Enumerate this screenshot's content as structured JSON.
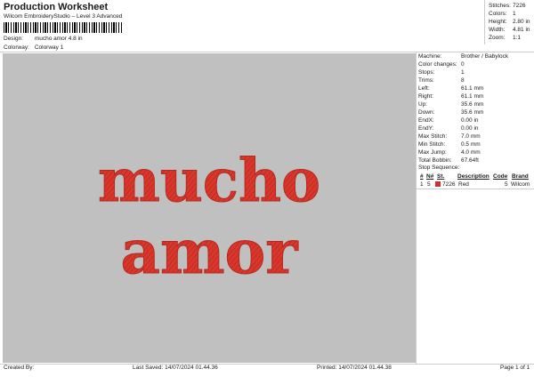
{
  "header": {
    "title": "Production Worksheet",
    "subtitle": "Wilcom EmbroideryStudio – Level 3 Advanced",
    "design_label": "Design:",
    "design_value": "mucho amor 4.8 in",
    "colorway_label": "Colorway:",
    "colorway_value": "Colorway 1"
  },
  "stats": {
    "stitches_label": "Stitches:",
    "stitches": "7226",
    "colors_label": "Colors:",
    "colors": "1",
    "height_label": "Height:",
    "height": "2.80 in",
    "width_label": "Width:",
    "width": "4.81 in",
    "zoom_label": "Zoom:",
    "zoom": "1:1"
  },
  "design": {
    "line1": "mucho",
    "line2": "amor",
    "thread_color": "#d9362c",
    "canvas_color": "#c0c0c0"
  },
  "properties": {
    "machine_label": "Machine:",
    "machine": "Brother / Babylock",
    "color_changes_label": "Color changes:",
    "color_changes": "0",
    "stops_label": "Stops:",
    "stops": "1",
    "trims_label": "Trims:",
    "trims": "8",
    "left_label": "Left:",
    "left": "61.1 mm",
    "right_label": "Right:",
    "right": "61.1 mm",
    "up_label": "Up:",
    "up": "35.6 mm",
    "down_label": "Down:",
    "down": "35.6 mm",
    "endx_label": "EndX:",
    "endx": "0.00 in",
    "endy_label": "EndY:",
    "endy": "0.00 in",
    "max_stitch_label": "Max Stitch:",
    "max_stitch": "7.0 mm",
    "min_stitch_label": "Min Stitch:",
    "min_stitch": "0.5 mm",
    "max_jump_label": "Max Jump:",
    "max_jump": "4.0 mm",
    "total_bobbin_label": "Total Bobbin:",
    "total_bobbin": "67.64ft"
  },
  "stop_sequence": {
    "title": "Stop Sequence:",
    "headers": {
      "num": "#",
      "n": "N#",
      "st": "St.",
      "description": "Description",
      "code": "Code",
      "brand": "Brand"
    },
    "rows": [
      {
        "num": "1",
        "n": "5",
        "st": "7226",
        "description": "Red",
        "code": "5",
        "brand": "Wilcom",
        "color": "#d32f2f"
      }
    ]
  },
  "footer": {
    "created_by": "Created By:",
    "last_saved": "Last Saved: 14/07/2024 01.44.36",
    "printed": "Printed: 14/07/2024 01.44.38",
    "page": "Page 1 of 1"
  }
}
